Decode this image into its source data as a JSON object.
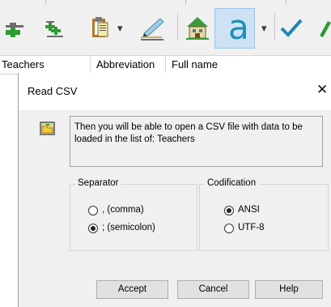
{
  "toolbar": {
    "buttons": [
      {
        "icon": "add-record-icon"
      },
      {
        "icon": "add-multiple-records-icon"
      },
      {
        "icon": "clipboard-paste-icon"
      },
      {
        "icon": "edit-pen-icon"
      },
      {
        "icon": "school-building-icon"
      },
      {
        "icon": "font-a-icon",
        "text": "a"
      },
      {
        "icon": "checkmark-icon"
      }
    ],
    "dropdown_glyph": "▾"
  },
  "grid": {
    "columns": [
      "Teachers",
      "Abbreviation",
      "Full name"
    ]
  },
  "dialog": {
    "title": "Read CSV",
    "close_glyph": "✕",
    "message": "Then you will be able to open a CSV file with data to be loaded in the list of:  Teachers",
    "separator": {
      "legend": "Separator",
      "options": [
        {
          "label": ", (comma)",
          "checked": false
        },
        {
          "label": "; (semicolon)",
          "checked": true
        }
      ]
    },
    "codification": {
      "legend": "Codification",
      "options": [
        {
          "label": "ANSI",
          "checked": true
        },
        {
          "label": "UTF-8",
          "checked": false
        }
      ]
    },
    "buttons": {
      "accept": "Accept",
      "cancel": "Cancel",
      "help": "Help"
    }
  },
  "colors": {
    "green_icon": "#2e9b32",
    "accent_blue": "#1c8fb7",
    "selected_button_bg": "#cde3f5"
  }
}
